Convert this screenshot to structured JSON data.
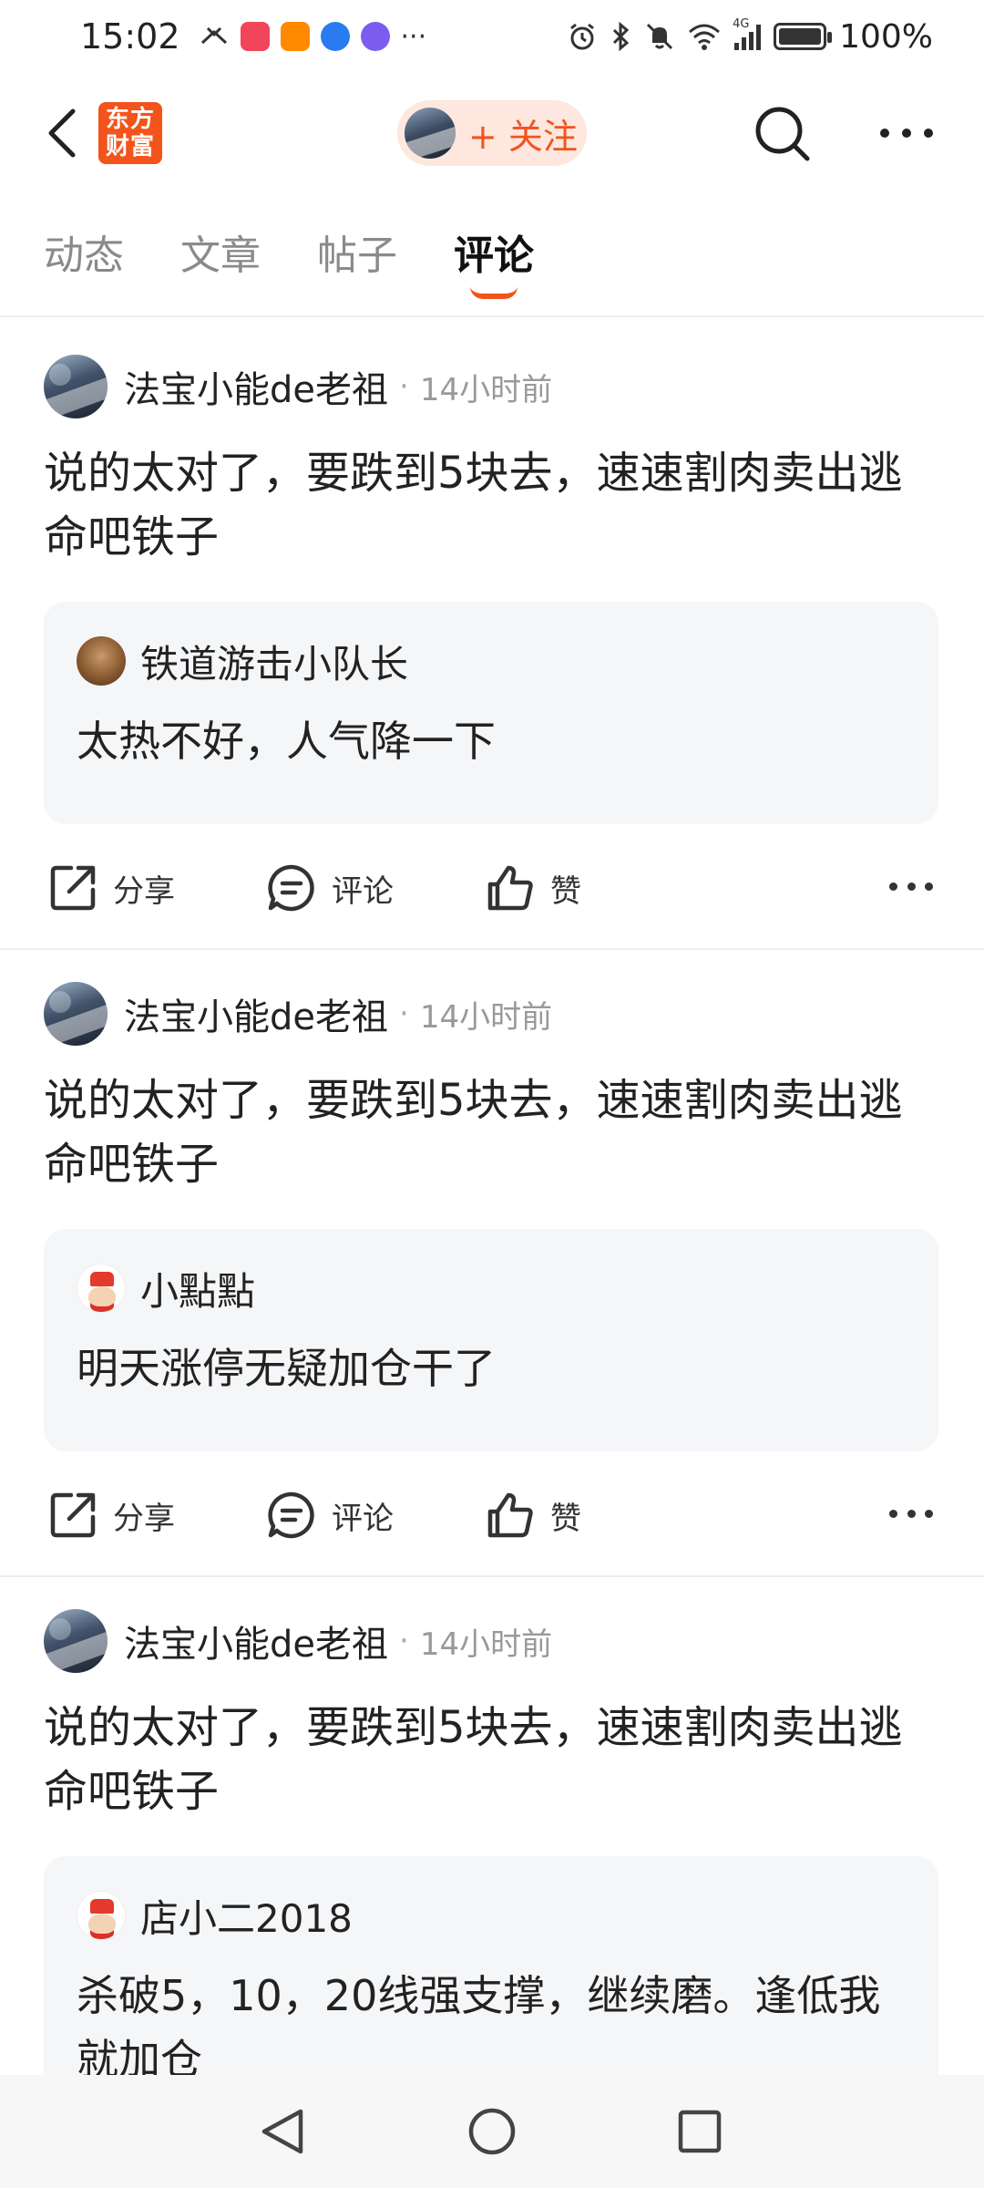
{
  "status_bar": {
    "time": "15:02",
    "more_dots": "···",
    "battery": "100%",
    "network": "4G",
    "app_icon_colors": [
      "#f0455a",
      "#ff8a00",
      "#2a7bf0",
      "#7a5cf0"
    ]
  },
  "header": {
    "back_icon": "back-chevron-icon",
    "brand_logo_line1": "东方",
    "brand_logo_line2": "财富",
    "follow_label": "+ 关注",
    "search_icon": "search-icon",
    "more_icon": "more-icon"
  },
  "tabs": [
    {
      "label": "动态",
      "active": false
    },
    {
      "label": "文章",
      "active": false
    },
    {
      "label": "帖子",
      "active": false
    },
    {
      "label": "评论",
      "active": true
    }
  ],
  "accent_color": "#f2541b",
  "comments": [
    {
      "author": "法宝小能de老祖",
      "separator": "·",
      "time": "14小时前",
      "text": "说的太对了，要跌到5块去，速速割肉卖出逃命吧铁子",
      "quoted": {
        "author": "铁道游击小队长",
        "text": "太热不好，人气降一下"
      },
      "actions": {
        "share": "分享",
        "comment": "评论",
        "like": "赞"
      }
    },
    {
      "author": "法宝小能de老祖",
      "separator": "·",
      "time": "14小时前",
      "text": "说的太对了，要跌到5块去，速速割肉卖出逃命吧铁子",
      "quoted": {
        "author": "小點點",
        "text": "明天涨停无疑加仓干了"
      },
      "actions": {
        "share": "分享",
        "comment": "评论",
        "like": "赞"
      }
    },
    {
      "author": "法宝小能de老祖",
      "separator": "·",
      "time": "14小时前",
      "text": "说的太对了，要跌到5块去，速速割肉卖出逃命吧铁子",
      "quoted": {
        "author": "店小二2018",
        "text": "杀破5，10，20线强支撑，继续磨。逢低我就加仓"
      }
    }
  ]
}
